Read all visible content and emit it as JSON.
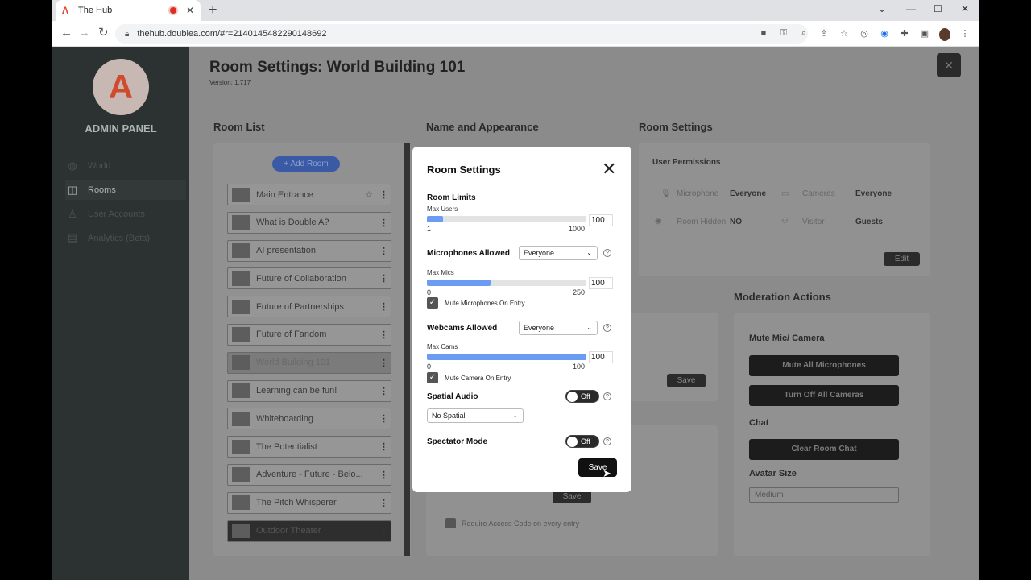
{
  "browser": {
    "tab_title": "The Hub",
    "url": "thehub.doublea.com/#r=2140145482290148692"
  },
  "sidebar": {
    "admin_label": "ADMIN PANEL",
    "items": [
      {
        "label": "World"
      },
      {
        "label": "Rooms"
      },
      {
        "label": "User Accounts"
      },
      {
        "label": "Analytics (Beta)"
      }
    ]
  },
  "page": {
    "title": "Room Settings: World Building 101",
    "version": "Version: 1.717"
  },
  "room_list": {
    "heading": "Room List",
    "add_label": "+ Add Room",
    "rooms": [
      "Main Entrance",
      "What is Double A?",
      "AI presentation",
      "Future of Collaboration",
      "Future of Partnerships",
      "Future of Fandom",
      "World Building 101",
      "Learning can be fun!",
      "Whiteboarding",
      "The Potentialist",
      "Adventure - Future - Belo...",
      "The Pitch Whisperer",
      "Outdoor Theater"
    ]
  },
  "name_appearance": {
    "heading": "Name and Appearance",
    "save_label": "Save",
    "save2_label": "Save",
    "require_code_label": "Require Access Code on every entry"
  },
  "room_settings_panel": {
    "heading": "Room Settings",
    "user_permissions": "User Permissions",
    "microphone_label": "Microphone",
    "microphone_value": "Everyone",
    "cameras_label": "Cameras",
    "cameras_value": "Everyone",
    "room_hidden_label": "Room Hidden",
    "room_hidden_value": "NO",
    "visitor_label": "Visitor",
    "visitor_value": "Guests",
    "edit_label": "Edit"
  },
  "moderation": {
    "heading": "Moderation Actions",
    "mute_heading": "Mute Mic/ Camera",
    "mute_all": "Mute All Microphones",
    "cams_off": "Turn Off All Cameras",
    "chat_heading": "Chat",
    "clear_chat": "Clear Room Chat",
    "avatar_heading": "Avatar Size",
    "avatar_value": "Medium"
  },
  "modal": {
    "title": "Room Settings",
    "room_limits": "Room Limits",
    "max_users_label": "Max Users",
    "max_users_value": "100",
    "max_users_fraction": 0.1,
    "max_users_min": "1",
    "max_users_max": "1000",
    "mics_label": "Microphones Allowed",
    "mics_select": "Everyone",
    "max_mics_label": "Max Mics",
    "max_mics_value": "100",
    "max_mics_fraction": 0.4,
    "max_mics_min": "0",
    "max_mics_max": "250",
    "mute_mics_label": "Mute Microphones On Entry",
    "webcams_label": "Webcams Allowed",
    "webcams_select": "Everyone",
    "max_cams_label": "Max Cams",
    "max_cams_value": "100",
    "max_cams_fraction": 1.0,
    "max_cams_min": "0",
    "max_cams_max": "100",
    "mute_cam_label": "Mute Camera On Entry",
    "spatial_label": "Spatial Audio",
    "spatial_toggle": "Off",
    "spatial_select": "No Spatial",
    "spectator_label": "Spectator Mode",
    "spectator_toggle": "Off",
    "save_label": "Save"
  }
}
